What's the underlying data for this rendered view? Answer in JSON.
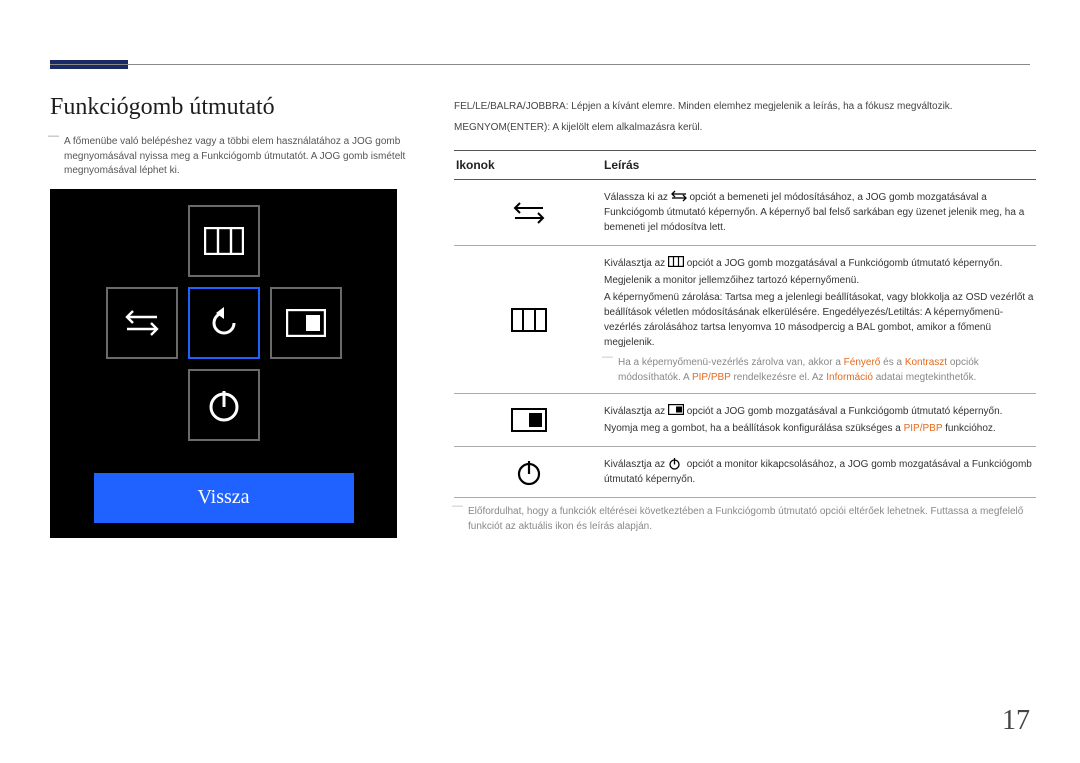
{
  "page_number": "17",
  "title": "Funkciógomb útmutató",
  "intro_note": "A főmenübe való belépéshez vagy a többi elem használatához a JOG gomb megnyomásával nyissa meg a Funkciógomb útmutatót. A JOG gomb ismételt megnyomásával léphet ki.",
  "osd_back": "Vissza",
  "instructions": {
    "line1": "FEL/LE/BALRA/JOBBRA: Lépjen a kívánt elemre. Minden elemhez megjelenik a leírás, ha a fókusz megváltozik.",
    "line2": "MEGNYOM(ENTER): A kijelölt elem alkalmazásra kerül."
  },
  "table_headers": {
    "icons": "Ikonok",
    "desc": "Leírás"
  },
  "rows": {
    "r1": {
      "p1a": "Válassza ki az ",
      "p1b": " opciót a bemeneti jel módosításához, a JOG gomb mozgatásával a Funkciógomb útmutató képernyőn. A képernyő bal felső sarkában egy üzenet jelenik meg, ha a bemeneti jel módosítva lett."
    },
    "r2": {
      "p1a": "Kiválasztja az ",
      "p1b": " opciót a JOG gomb mozgatásával a Funkciógomb útmutató képernyőn.",
      "p2": "Megjelenik a monitor jellemzőihez tartozó képernyőmenü.",
      "p3": "A képernyőmenü zárolása: Tartsa meg a jelenlegi beállításokat, vagy blokkolja az OSD vezérlőt a beállítások véletlen módosításának elkerülésére. Engedélyezés/Letiltás: A képernyőmenü-vezérlés zárolásához tartsa lenyomva 10 másodpercig a BAL gombot, amikor a főmenü megjelenik.",
      "note_a": "Ha a képernyőmenü-vezérlés zárolva van, akkor a ",
      "note_fen": "Fényerő",
      "note_es": " és a ",
      "note_kon": "Kontraszt",
      "note_b": " opciók módosíthatók. A ",
      "note_pip": "PIP/PBP",
      "note_c": " rendelkezésre el. Az ",
      "note_info": "Információ",
      "note_d": " adatai megtekinthetők."
    },
    "r3": {
      "p1a": "Kiválasztja az ",
      "p1b": " opciót a JOG gomb mozgatásával a Funkciógomb útmutató képernyőn.",
      "p2a": "Nyomja meg a gombot, ha a beállítások konfigurálása szükséges a ",
      "p2_pip": "PIP/PBP",
      "p2b": " funkcióhoz."
    },
    "r4": {
      "p1a": "Kiválasztja az ",
      "p1b": " opciót a monitor kikapcsolásához, a JOG gomb mozgatásával a Funkciógomb útmutató képernyőn."
    }
  },
  "footnote": "Előfordulhat, hogy a funkciók eltérései következtében a Funkciógomb útmutató opciói eltérőek lehetnek. Futtassa a megfelelő funkciót az aktuális ikon és leírás alapján."
}
